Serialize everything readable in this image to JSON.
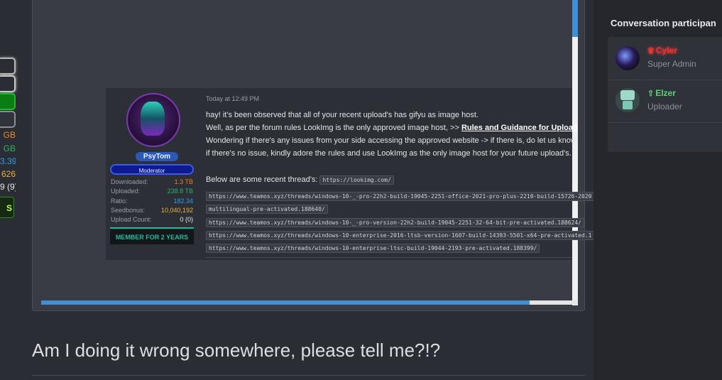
{
  "left_sidebar": {
    "stats": [
      {
        "text": "GB",
        "color": "#f08a24"
      },
      {
        "text": "GB",
        "color": "#2bb26b"
      },
      {
        "text": "3.39",
        "color": "#2f9ee8"
      },
      {
        "text": "626",
        "color": "#f0b040"
      },
      {
        "text": "9 (9)",
        "color": "#e6e6e6"
      }
    ],
    "badge_text": "S"
  },
  "post_image": {
    "timestamp": "Today at 12:49 PM",
    "user": {
      "name": "PsyTom",
      "role": "Moderator",
      "stats": [
        {
          "label": "Downloaded:",
          "value": "1.3 TB",
          "color": "#f07a24"
        },
        {
          "label": "Uploaded:",
          "value": "238.8 TB",
          "color": "#2bb26b"
        },
        {
          "label": "Ratio:",
          "value": "182.34",
          "color": "#2f9ee8"
        },
        {
          "label": "Seedbonus:",
          "value": "10,040,192",
          "color": "#f0b040"
        },
        {
          "label": "Upload Count:",
          "value": "0 (0)",
          "color": "#e6e6e6"
        }
      ],
      "member_badge": "MEMBER FOR 2 YEARS"
    },
    "message": {
      "line1": "hay! it's been observed that all of your recent upload's has gifyu as image host.",
      "line2_prefix": "Well, as per the forum rules LookImg is the only approved image host, >> ",
      "line2_link": "Rules and Guidance for Upload",
      "line3": "Wondering if there's any issues from your side accessing the approved website -> if there is, do let us know",
      "line4": "if there's no issue, kindly adore the rules and use LookImg as the only image host for your future upload's.",
      "recent_label": "Below are some recent thread's: ",
      "recent_code": "https://lookimg.com/",
      "links": [
        "https://www.teamos.xyz/threads/windows-10-_-pro-22h2-build-19045-2251-office-2021-pro-plus-2210-build-15726-2020",
        "multilingual-pre-activated.188640/",
        "https://www.teamos.xyz/threads/windows-10-_-pro-version-22h2-build-19045-2251-32-64-bit-pre-activated.188624/",
        "https://www.teamos.xyz/threads/windows-10-enterprise-2016-ltsb-version-1607-build-14393-5501-x64-pre-activated.1",
        "https://www.teamos.xyz/threads/windows-10-enterprise-ltsc-build-19044-2193-pre-activated.188399/"
      ]
    }
  },
  "post_text": "Am I doing it wrong somewhere, please tell me?!?",
  "participants": {
    "title": "Conversation participan",
    "items": [
      {
        "name": "Cyler",
        "role": "Super Admin",
        "icon": "crown-icon",
        "color": "#ff2a2a"
      },
      {
        "name": "Elzer",
        "role": "Uploader",
        "icon": "cloud-upload-icon",
        "color": "#5fd27a"
      }
    ]
  }
}
